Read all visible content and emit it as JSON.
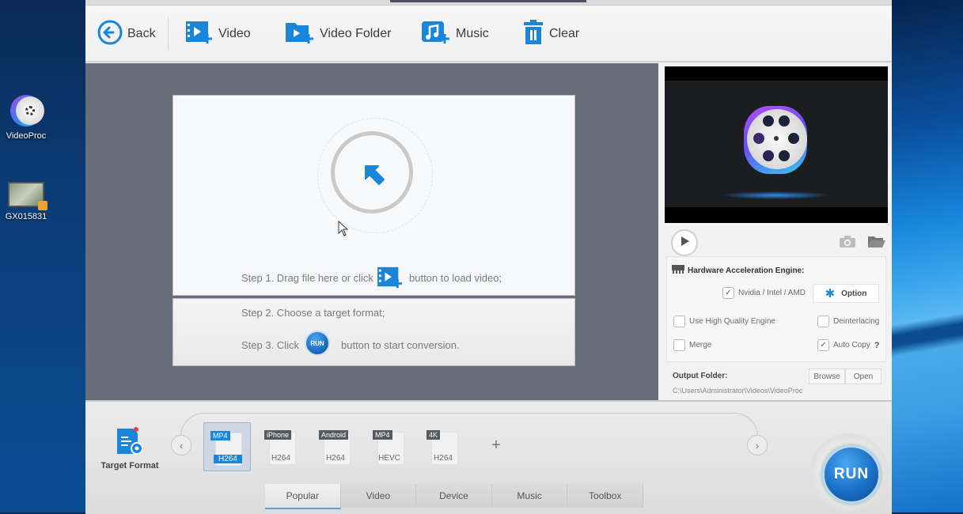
{
  "desktop": {
    "icons": [
      {
        "label": "VideoProc",
        "icon": "videoproc-app-icon"
      },
      {
        "label": "GX015831",
        "icon": "video-file-icon"
      }
    ]
  },
  "toolbar": {
    "back_label": "Back",
    "video_label": "Video",
    "video_folder_label": "Video Folder",
    "music_label": "Music",
    "clear_label": "Clear"
  },
  "dropzone": {
    "step1_before": "Step 1. Drag file here or click",
    "step1_after": "button to load video;",
    "step2": "Step 2. Choose a target format;",
    "step3_before": "Step 3. Click",
    "step3_run": "RUN",
    "step3_after": "button to start conversion."
  },
  "hardware": {
    "title": "Hardware Acceleration Engine:",
    "gpu_label": "Nvidia / Intel / AMD",
    "gpu_checked": true,
    "option_label": "Option",
    "high_quality_label": "Use High Quality Engine",
    "high_quality_checked": false,
    "deinterlacing_label": "Deinterlacing",
    "deinterlacing_checked": false,
    "merge_label": "Merge",
    "merge_checked": false,
    "autocopy_label": "Auto Copy",
    "autocopy_checked": true,
    "help_label": "?"
  },
  "output": {
    "label": "Output Folder:",
    "browse_label": "Browse",
    "open_label": "Open",
    "path": "C:\\Users\\Administrator\\Videos\\VideoProc"
  },
  "target_format": {
    "label": "Target Format",
    "formats": [
      {
        "top": "MP4",
        "sub": "H264",
        "selected": true
      },
      {
        "top": "iPhone",
        "sub": "H264",
        "selected": false
      },
      {
        "top": "Android",
        "sub": "H264",
        "selected": false
      },
      {
        "top": "MP4",
        "sub": "HEVC",
        "selected": false
      },
      {
        "top": "4K",
        "sub": "H264",
        "selected": false
      }
    ],
    "add_label": "+"
  },
  "tabs": [
    {
      "label": "Popular",
      "active": true
    },
    {
      "label": "Video",
      "active": false
    },
    {
      "label": "Device",
      "active": false
    },
    {
      "label": "Music",
      "active": false
    },
    {
      "label": "Toolbox",
      "active": false
    }
  ],
  "run_label": "RUN",
  "colors": {
    "accent": "#1a86d9",
    "run": "#1a6fc6"
  }
}
